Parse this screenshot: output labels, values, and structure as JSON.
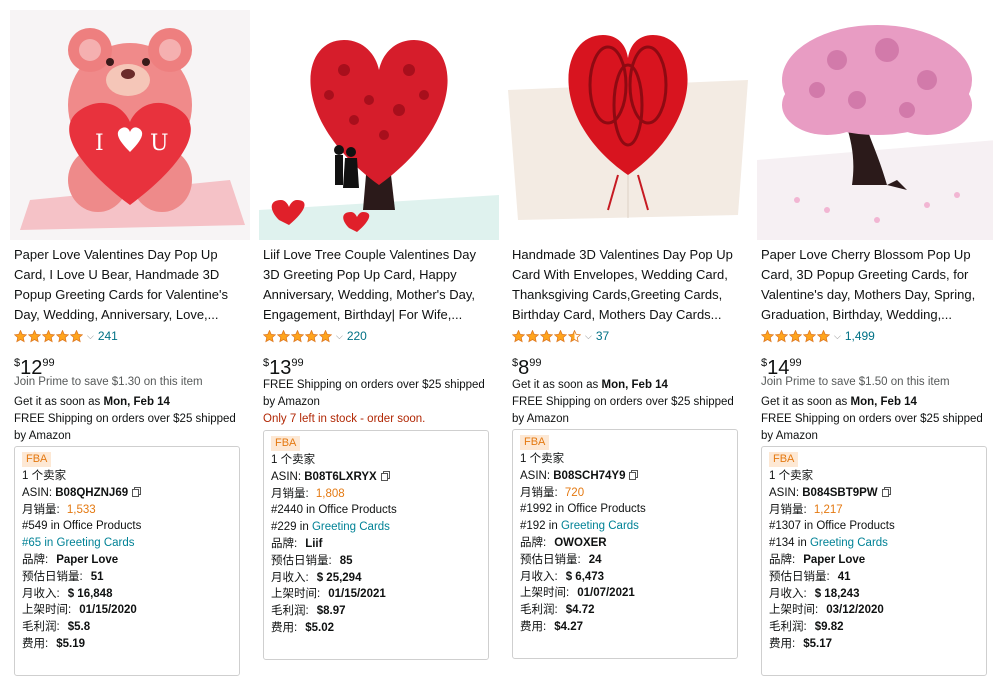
{
  "products": [
    {
      "title": "Paper Love Valentines Day Pop Up Card, I Love U Bear, Handmade 3D Popup Greeting Cards for Valentine's Day, Wedding, Anniversary, Love,...",
      "rating_count": "241",
      "rating": 5,
      "price_symbol": "$",
      "price_whole": "12",
      "price_cents": "99",
      "info_lines": [
        "Join Prime to save $1.30 on this item"
      ],
      "delivery_prefix": "Get it as soon as ",
      "delivery_date": "Mon, Feb 14",
      "shipping": "FREE Shipping on orders over $25 shipped by Amazon",
      "stock_note": "",
      "ext": {
        "fba": "FBA",
        "sellers": "1 个卖家",
        "asin_label": "ASIN:",
        "asin": "B08QHZNJ69",
        "monthly_sales_label": "月销量:",
        "monthly_sales": "1,533",
        "rank_main_prefix": "#549 in ",
        "rank_main_cat": "Office Products",
        "rank_sub_prefix": "#65 in ",
        "rank_sub_cat": "Greeting Cards",
        "brand_label": "品牌:",
        "brand": "Paper Love",
        "daily_label": "预估日销量:",
        "daily": "51",
        "revenue_label": "月收入:",
        "revenue": "$ 16,848",
        "date_label": "上架时间:",
        "date": "01/15/2020",
        "margin_label": "毛利润:",
        "margin": "$5.8",
        "fee_label": "费用:",
        "fee": "$5.19",
        "rank_first": true
      }
    },
    {
      "title": "Liif Love Tree Couple Valentines Day 3D Greeting Pop Up Card, Happy Anniversary, Wedding, Mother's Day, Engagement, Birthday| For Wife,...",
      "rating_count": "220",
      "rating": 5,
      "price_symbol": "$",
      "price_whole": "13",
      "price_cents": "99",
      "info_lines": [],
      "delivery_prefix": "",
      "delivery_date": "",
      "shipping": "FREE Shipping on orders over $25 shipped by Amazon",
      "stock_note": "Only 7 left in stock - order soon.",
      "ext": {
        "fba": "FBA",
        "sellers": "1 个卖家",
        "asin_label": "ASIN:",
        "asin": "B08T6LXRYX",
        "monthly_sales_label": "月销量:",
        "monthly_sales": "1,808",
        "rank_main_prefix": "#2440 in ",
        "rank_main_cat": "Office Products",
        "rank_sub_prefix": "#229 in ",
        "rank_sub_cat": "Greeting Cards",
        "brand_label": "品牌:",
        "brand": "Liif",
        "daily_label": "预估日销量:",
        "daily": "85",
        "revenue_label": "月收入:",
        "revenue": "$ 25,294",
        "date_label": "上架时间:",
        "date": "01/15/2021",
        "margin_label": "毛利润:",
        "margin": "$8.97",
        "fee_label": "费用:",
        "fee": "$5.02",
        "rank_first": false
      }
    },
    {
      "title": "Handmade 3D Valentines Day Pop Up Card With Envelopes, Wedding Card, Thanksgiving Cards,Greeting Cards, Birthday Card, Mothers Day Cards...",
      "rating_count": "37",
      "rating": 4.5,
      "price_symbol": "$",
      "price_whole": "8",
      "price_cents": "99",
      "info_lines": [],
      "delivery_prefix": "Get it as soon as ",
      "delivery_date": "Mon, Feb 14",
      "shipping": "FREE Shipping on orders over $25 shipped by Amazon",
      "stock_note": "",
      "ext": {
        "fba": "FBA",
        "sellers": "1 个卖家",
        "asin_label": "ASIN:",
        "asin": "B08SCH74Y9",
        "monthly_sales_label": "月销量:",
        "monthly_sales": "720",
        "rank_main_prefix": "#1992 in ",
        "rank_main_cat": "Office Products",
        "rank_sub_prefix": "#192 in ",
        "rank_sub_cat": "Greeting Cards",
        "brand_label": "品牌:",
        "brand": "OWOXER",
        "daily_label": "预估日销量:",
        "daily": "24",
        "revenue_label": "月收入:",
        "revenue": "$ 6,473",
        "date_label": "上架时间:",
        "date": "01/07/2021",
        "margin_label": "毛利润:",
        "margin": "$4.72",
        "fee_label": "费用:",
        "fee": "$4.27",
        "rank_first": false
      }
    },
    {
      "title": "Paper Love Cherry Blossom Pop Up Card, 3D Popup Greeting Cards, for Valentine's day, Mothers Day, Spring, Graduation, Birthday, Wedding,...",
      "rating_count": "1,499",
      "rating": 5,
      "price_symbol": "$",
      "price_whole": "14",
      "price_cents": "99",
      "info_lines": [
        "Join Prime to save $1.50 on this item"
      ],
      "delivery_prefix": "Get it as soon as ",
      "delivery_date": "Mon, Feb 14",
      "shipping": "FREE Shipping on orders over $25 shipped by Amazon",
      "stock_note": "",
      "ext": {
        "fba": "FBA",
        "sellers": "1 个卖家",
        "asin_label": "ASIN:",
        "asin": "B084SBT9PW",
        "monthly_sales_label": "月销量:",
        "monthly_sales": "1,217",
        "rank_main_prefix": "#1307 in ",
        "rank_main_cat": "Office Products",
        "rank_sub_prefix": "#134 in ",
        "rank_sub_cat": "Greeting Cards",
        "brand_label": "品牌:",
        "brand": "Paper Love",
        "daily_label": "预估日销量:",
        "daily": "41",
        "revenue_label": "月收入:",
        "revenue": "$ 18,243",
        "date_label": "上架时间:",
        "date": "03/12/2020",
        "margin_label": "毛利润:",
        "margin": "$9.82",
        "fee_label": "费用:",
        "fee": "$5.17",
        "rank_first": false
      }
    }
  ],
  "colors": {
    "star": "#ffa41c",
    "link": "#007185",
    "fba_bg": "#fde8d4",
    "fba_text": "#e47911",
    "stock_red": "#b12704",
    "teal": "#008296"
  },
  "icons": [
    "star-icon",
    "chevron-down-icon",
    "copy-icon"
  ]
}
